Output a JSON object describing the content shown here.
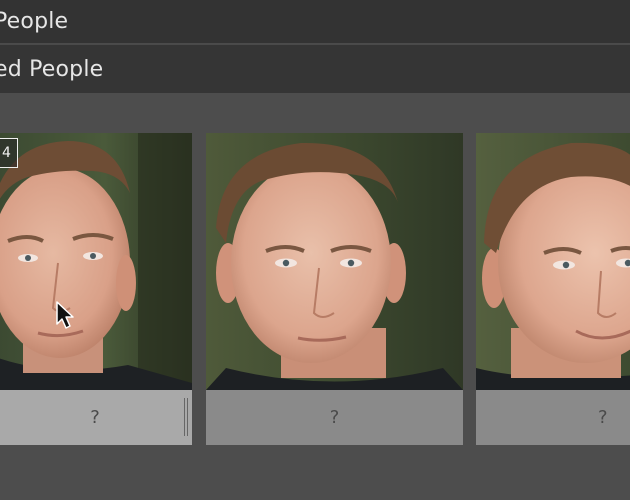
{
  "sections": {
    "top_header": "People",
    "second_header": "ed People"
  },
  "faces": [
    {
      "label": "?",
      "selected": true,
      "face_count": "4"
    },
    {
      "label": "?",
      "selected": false
    },
    {
      "label": "?",
      "selected": false
    }
  ],
  "colors": {
    "header_bg": "#333333",
    "grid_bg": "#4d4d4d",
    "label_bar": "#8a8a8a",
    "label_bar_selected": "#a9a9a9"
  }
}
